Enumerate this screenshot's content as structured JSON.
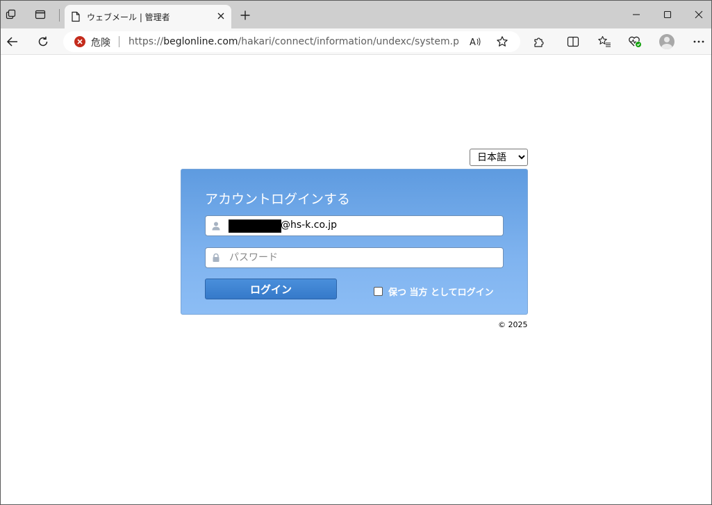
{
  "browser": {
    "tab_title": "ウェブメール | 管理者",
    "security_label": "危険",
    "url_scheme": "https://",
    "url_host": "beglonline.com",
    "url_path": "/hakari/connect/information/undexc/system.php?pr...",
    "read_aloud_icon": "A"
  },
  "page": {
    "language_selected": "日本語",
    "card_title": "アカウントログインする",
    "email_suffix": "@hs-k.co.jp",
    "password_placeholder": "パスワード",
    "login_button": "ログイン",
    "remember_label": "保つ 当方 としてログイン",
    "copyright": "© 2025"
  },
  "colors": {
    "danger": "#c42b1c",
    "card_top": "#5e9be0",
    "card_bottom": "#8cbdf5",
    "button": "#3579c9"
  }
}
